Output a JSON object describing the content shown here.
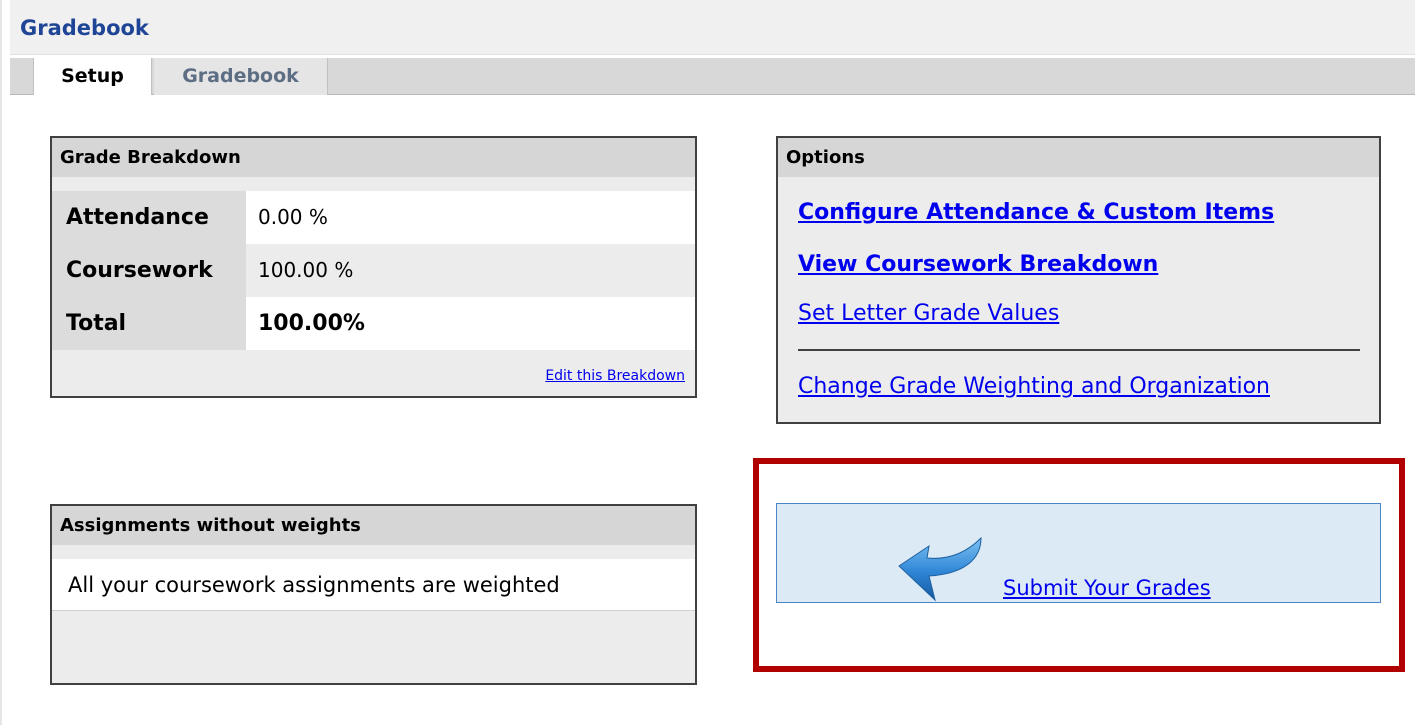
{
  "header": {
    "title": "Gradebook"
  },
  "tabs": [
    {
      "label": "Setup",
      "active": true
    },
    {
      "label": "Gradebook",
      "active": false
    }
  ],
  "grade_breakdown": {
    "title": "Grade Breakdown",
    "rows": [
      {
        "label": "Attendance",
        "value": "0.00 %"
      },
      {
        "label": "Coursework",
        "value": "100.00 %"
      },
      {
        "label": "Total",
        "value": "100.00%"
      }
    ],
    "edit_link": "Edit this Breakdown"
  },
  "options": {
    "title": "Options",
    "links": [
      {
        "label": "Configure Attendance & Custom Items"
      },
      {
        "label": "View Coursework Breakdown"
      },
      {
        "label": "Set Letter Grade Values"
      },
      {
        "label": "Change Grade Weighting and Organization"
      }
    ]
  },
  "assignments_without_weights": {
    "title": "Assignments without weights",
    "message": "All your coursework assignments are weighted"
  },
  "submit": {
    "label": "Submit Your Grades",
    "icon": "curved-arrow-icon"
  },
  "colors": {
    "header_title": "#1f4596",
    "link": "#0000ee",
    "highlight": "#b00000",
    "submit_bg": "#dceaf6"
  }
}
